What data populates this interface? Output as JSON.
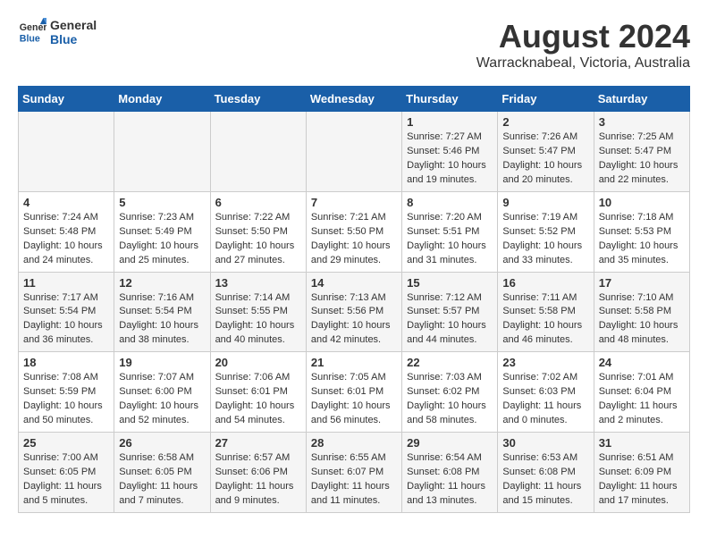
{
  "header": {
    "logo_line1": "General",
    "logo_line2": "Blue",
    "title": "August 2024",
    "subtitle": "Warracknabeal, Victoria, Australia"
  },
  "days_of_week": [
    "Sunday",
    "Monday",
    "Tuesday",
    "Wednesday",
    "Thursday",
    "Friday",
    "Saturday"
  ],
  "weeks": [
    {
      "days": [
        {
          "num": "",
          "info": ""
        },
        {
          "num": "",
          "info": ""
        },
        {
          "num": "",
          "info": ""
        },
        {
          "num": "",
          "info": ""
        },
        {
          "num": "1",
          "info": "Sunrise: 7:27 AM\nSunset: 5:46 PM\nDaylight: 10 hours\nand 19 minutes."
        },
        {
          "num": "2",
          "info": "Sunrise: 7:26 AM\nSunset: 5:47 PM\nDaylight: 10 hours\nand 20 minutes."
        },
        {
          "num": "3",
          "info": "Sunrise: 7:25 AM\nSunset: 5:47 PM\nDaylight: 10 hours\nand 22 minutes."
        }
      ]
    },
    {
      "days": [
        {
          "num": "4",
          "info": "Sunrise: 7:24 AM\nSunset: 5:48 PM\nDaylight: 10 hours\nand 24 minutes."
        },
        {
          "num": "5",
          "info": "Sunrise: 7:23 AM\nSunset: 5:49 PM\nDaylight: 10 hours\nand 25 minutes."
        },
        {
          "num": "6",
          "info": "Sunrise: 7:22 AM\nSunset: 5:50 PM\nDaylight: 10 hours\nand 27 minutes."
        },
        {
          "num": "7",
          "info": "Sunrise: 7:21 AM\nSunset: 5:50 PM\nDaylight: 10 hours\nand 29 minutes."
        },
        {
          "num": "8",
          "info": "Sunrise: 7:20 AM\nSunset: 5:51 PM\nDaylight: 10 hours\nand 31 minutes."
        },
        {
          "num": "9",
          "info": "Sunrise: 7:19 AM\nSunset: 5:52 PM\nDaylight: 10 hours\nand 33 minutes."
        },
        {
          "num": "10",
          "info": "Sunrise: 7:18 AM\nSunset: 5:53 PM\nDaylight: 10 hours\nand 35 minutes."
        }
      ]
    },
    {
      "days": [
        {
          "num": "11",
          "info": "Sunrise: 7:17 AM\nSunset: 5:54 PM\nDaylight: 10 hours\nand 36 minutes."
        },
        {
          "num": "12",
          "info": "Sunrise: 7:16 AM\nSunset: 5:54 PM\nDaylight: 10 hours\nand 38 minutes."
        },
        {
          "num": "13",
          "info": "Sunrise: 7:14 AM\nSunset: 5:55 PM\nDaylight: 10 hours\nand 40 minutes."
        },
        {
          "num": "14",
          "info": "Sunrise: 7:13 AM\nSunset: 5:56 PM\nDaylight: 10 hours\nand 42 minutes."
        },
        {
          "num": "15",
          "info": "Sunrise: 7:12 AM\nSunset: 5:57 PM\nDaylight: 10 hours\nand 44 minutes."
        },
        {
          "num": "16",
          "info": "Sunrise: 7:11 AM\nSunset: 5:58 PM\nDaylight: 10 hours\nand 46 minutes."
        },
        {
          "num": "17",
          "info": "Sunrise: 7:10 AM\nSunset: 5:58 PM\nDaylight: 10 hours\nand 48 minutes."
        }
      ]
    },
    {
      "days": [
        {
          "num": "18",
          "info": "Sunrise: 7:08 AM\nSunset: 5:59 PM\nDaylight: 10 hours\nand 50 minutes."
        },
        {
          "num": "19",
          "info": "Sunrise: 7:07 AM\nSunset: 6:00 PM\nDaylight: 10 hours\nand 52 minutes."
        },
        {
          "num": "20",
          "info": "Sunrise: 7:06 AM\nSunset: 6:01 PM\nDaylight: 10 hours\nand 54 minutes."
        },
        {
          "num": "21",
          "info": "Sunrise: 7:05 AM\nSunset: 6:01 PM\nDaylight: 10 hours\nand 56 minutes."
        },
        {
          "num": "22",
          "info": "Sunrise: 7:03 AM\nSunset: 6:02 PM\nDaylight: 10 hours\nand 58 minutes."
        },
        {
          "num": "23",
          "info": "Sunrise: 7:02 AM\nSunset: 6:03 PM\nDaylight: 11 hours\nand 0 minutes."
        },
        {
          "num": "24",
          "info": "Sunrise: 7:01 AM\nSunset: 6:04 PM\nDaylight: 11 hours\nand 2 minutes."
        }
      ]
    },
    {
      "days": [
        {
          "num": "25",
          "info": "Sunrise: 7:00 AM\nSunset: 6:05 PM\nDaylight: 11 hours\nand 5 minutes."
        },
        {
          "num": "26",
          "info": "Sunrise: 6:58 AM\nSunset: 6:05 PM\nDaylight: 11 hours\nand 7 minutes."
        },
        {
          "num": "27",
          "info": "Sunrise: 6:57 AM\nSunset: 6:06 PM\nDaylight: 11 hours\nand 9 minutes."
        },
        {
          "num": "28",
          "info": "Sunrise: 6:55 AM\nSunset: 6:07 PM\nDaylight: 11 hours\nand 11 minutes."
        },
        {
          "num": "29",
          "info": "Sunrise: 6:54 AM\nSunset: 6:08 PM\nDaylight: 11 hours\nand 13 minutes."
        },
        {
          "num": "30",
          "info": "Sunrise: 6:53 AM\nSunset: 6:08 PM\nDaylight: 11 hours\nand 15 minutes."
        },
        {
          "num": "31",
          "info": "Sunrise: 6:51 AM\nSunset: 6:09 PM\nDaylight: 11 hours\nand 17 minutes."
        }
      ]
    }
  ]
}
